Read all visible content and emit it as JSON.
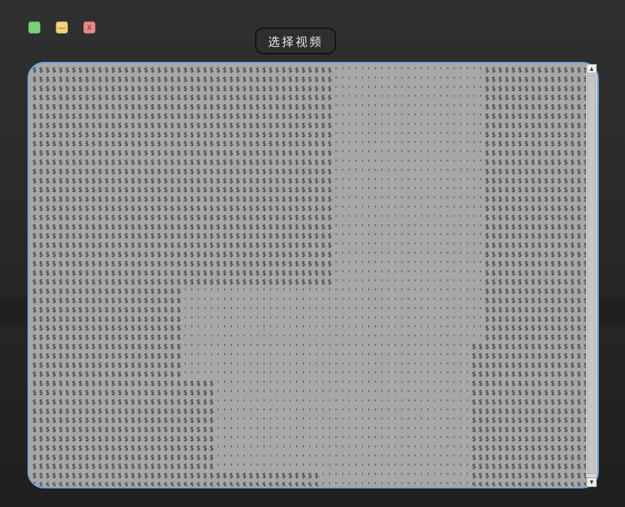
{
  "window": {
    "title": "选择视频",
    "controls": {
      "maximize_icon": "maximize-icon",
      "minimize_icon": "minimize-icon",
      "minimize_glyph": "—",
      "close_icon": "close-icon",
      "close_glyph": "X"
    }
  },
  "ascii_view": {
    "fill_char": "$",
    "light_char": "'",
    "colors": {
      "panel_bg": "#a7a7a7",
      "text": "#1c1c1c",
      "border": "#6fa4de"
    }
  },
  "scrollbar": {
    "up_glyph": "▲",
    "down_glyph": "▼"
  }
}
